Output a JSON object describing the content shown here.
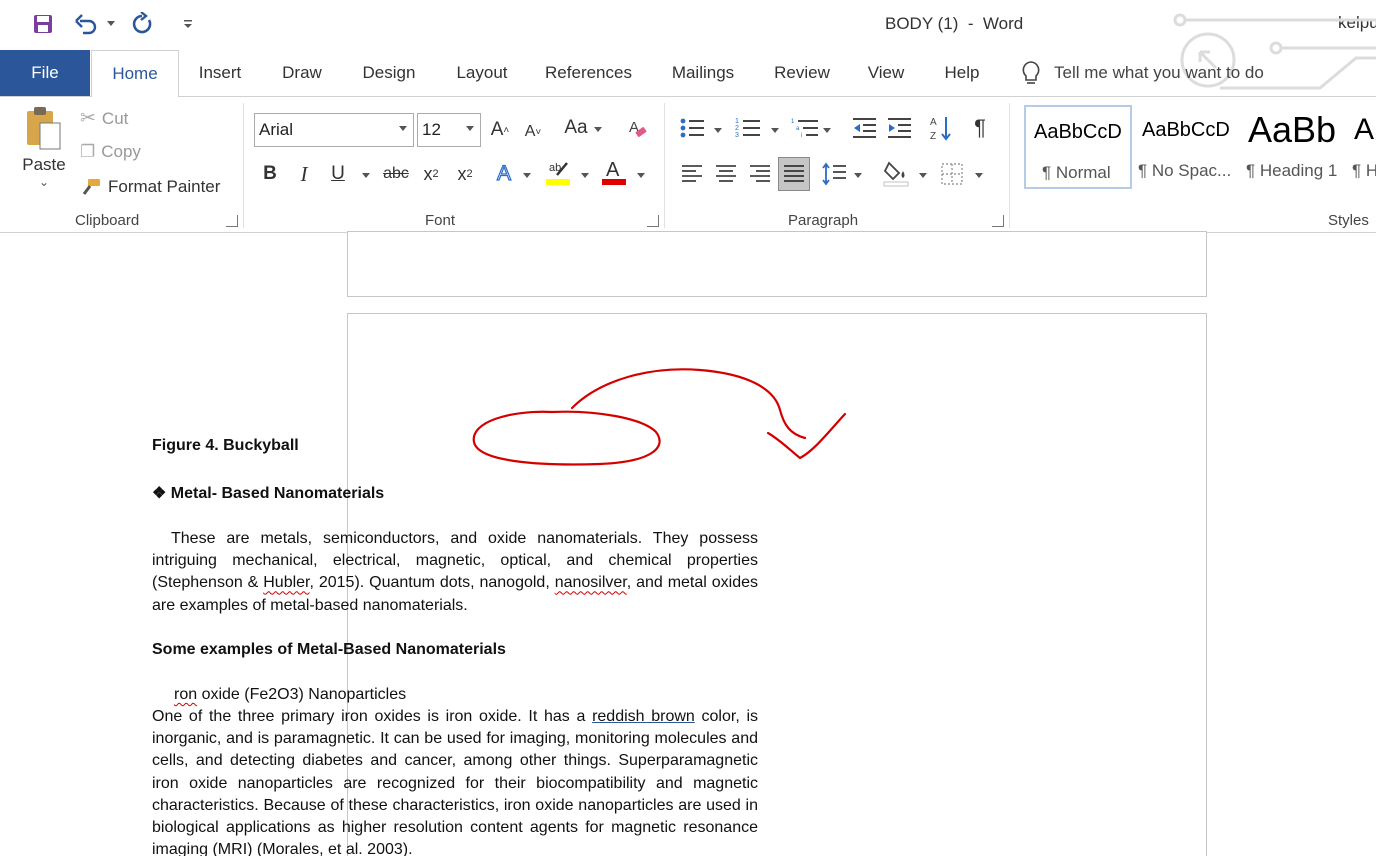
{
  "titlebar": {
    "title": "BODY (1)  -  Word",
    "user": "kelpu",
    "save_icon": "save-icon",
    "undo_icon": "undo-icon",
    "redo_icon": "redo-icon",
    "customize_icon": "customize-qat-icon"
  },
  "tabs": {
    "file": "File",
    "items": [
      "Home",
      "Insert",
      "Draw",
      "Design",
      "Layout",
      "References",
      "Mailings",
      "Review",
      "View",
      "Help"
    ],
    "active": "Home",
    "tell_me": "Tell me what you want to do"
  },
  "clipboard": {
    "paste": "Paste",
    "cut": "Cut",
    "copy": "Copy",
    "format_painter": "Format Painter",
    "label": "Clipboard"
  },
  "font": {
    "name": "Arial",
    "size": "12",
    "change_case": "Aa",
    "label": "Font",
    "highlight_color": "#ffff00",
    "font_color": "#e00000"
  },
  "paragraph": {
    "label": "Paragraph"
  },
  "styles": {
    "label": "Styles",
    "items": [
      {
        "sample": "AaBbCcD",
        "name": "¶ Normal"
      },
      {
        "sample": "AaBbCcD",
        "name": "¶ No Spac..."
      },
      {
        "sample": "AaBb",
        "name": "¶ Heading 1"
      },
      {
        "sample": "A",
        "name": "¶ H"
      }
    ]
  },
  "document": {
    "figure_caption": "Figure 4. Buckyball",
    "heading1": "❖ Metal- Based Nanomaterials",
    "para1": {
      "a": "These are metals, semiconductors, and oxide nanomaterials. They possess intriguing mechanical, electrical, magnetic, optical, and chemical properties (Stephenson & ",
      "b": "Hubler",
      "c": ", 2015). Quantum dots, nanogold, ",
      "d": "nanosilver",
      "e": ", and metal oxides are examples of metal-based nanomaterials."
    },
    "heading2": "Some examples of Metal-Based Nanomaterials",
    "subitem_a": "ron",
    "subitem_b": " oxide (Fe2O3) Nanoparticles",
    "para2": {
      "a": "One of the three primary iron oxides is iron oxide. It has a ",
      "b": "reddish brown",
      "c": " color, is inorganic, and is paramagnetic. It can be used for imaging, monitoring molecules and cells, and detecting diabetes and cancer, among other things. Superparamagnetic iron oxide nanoparticles are recognized for their biocompatibility and magnetic characteristics. Because of these characteristics, iron oxide nanoparticles are used in biological applications as higher resolution content agents for magnetic resonance imaging (MRI) (Morales, et al. 2003)."
    },
    "annotation_color": "#d40000"
  }
}
